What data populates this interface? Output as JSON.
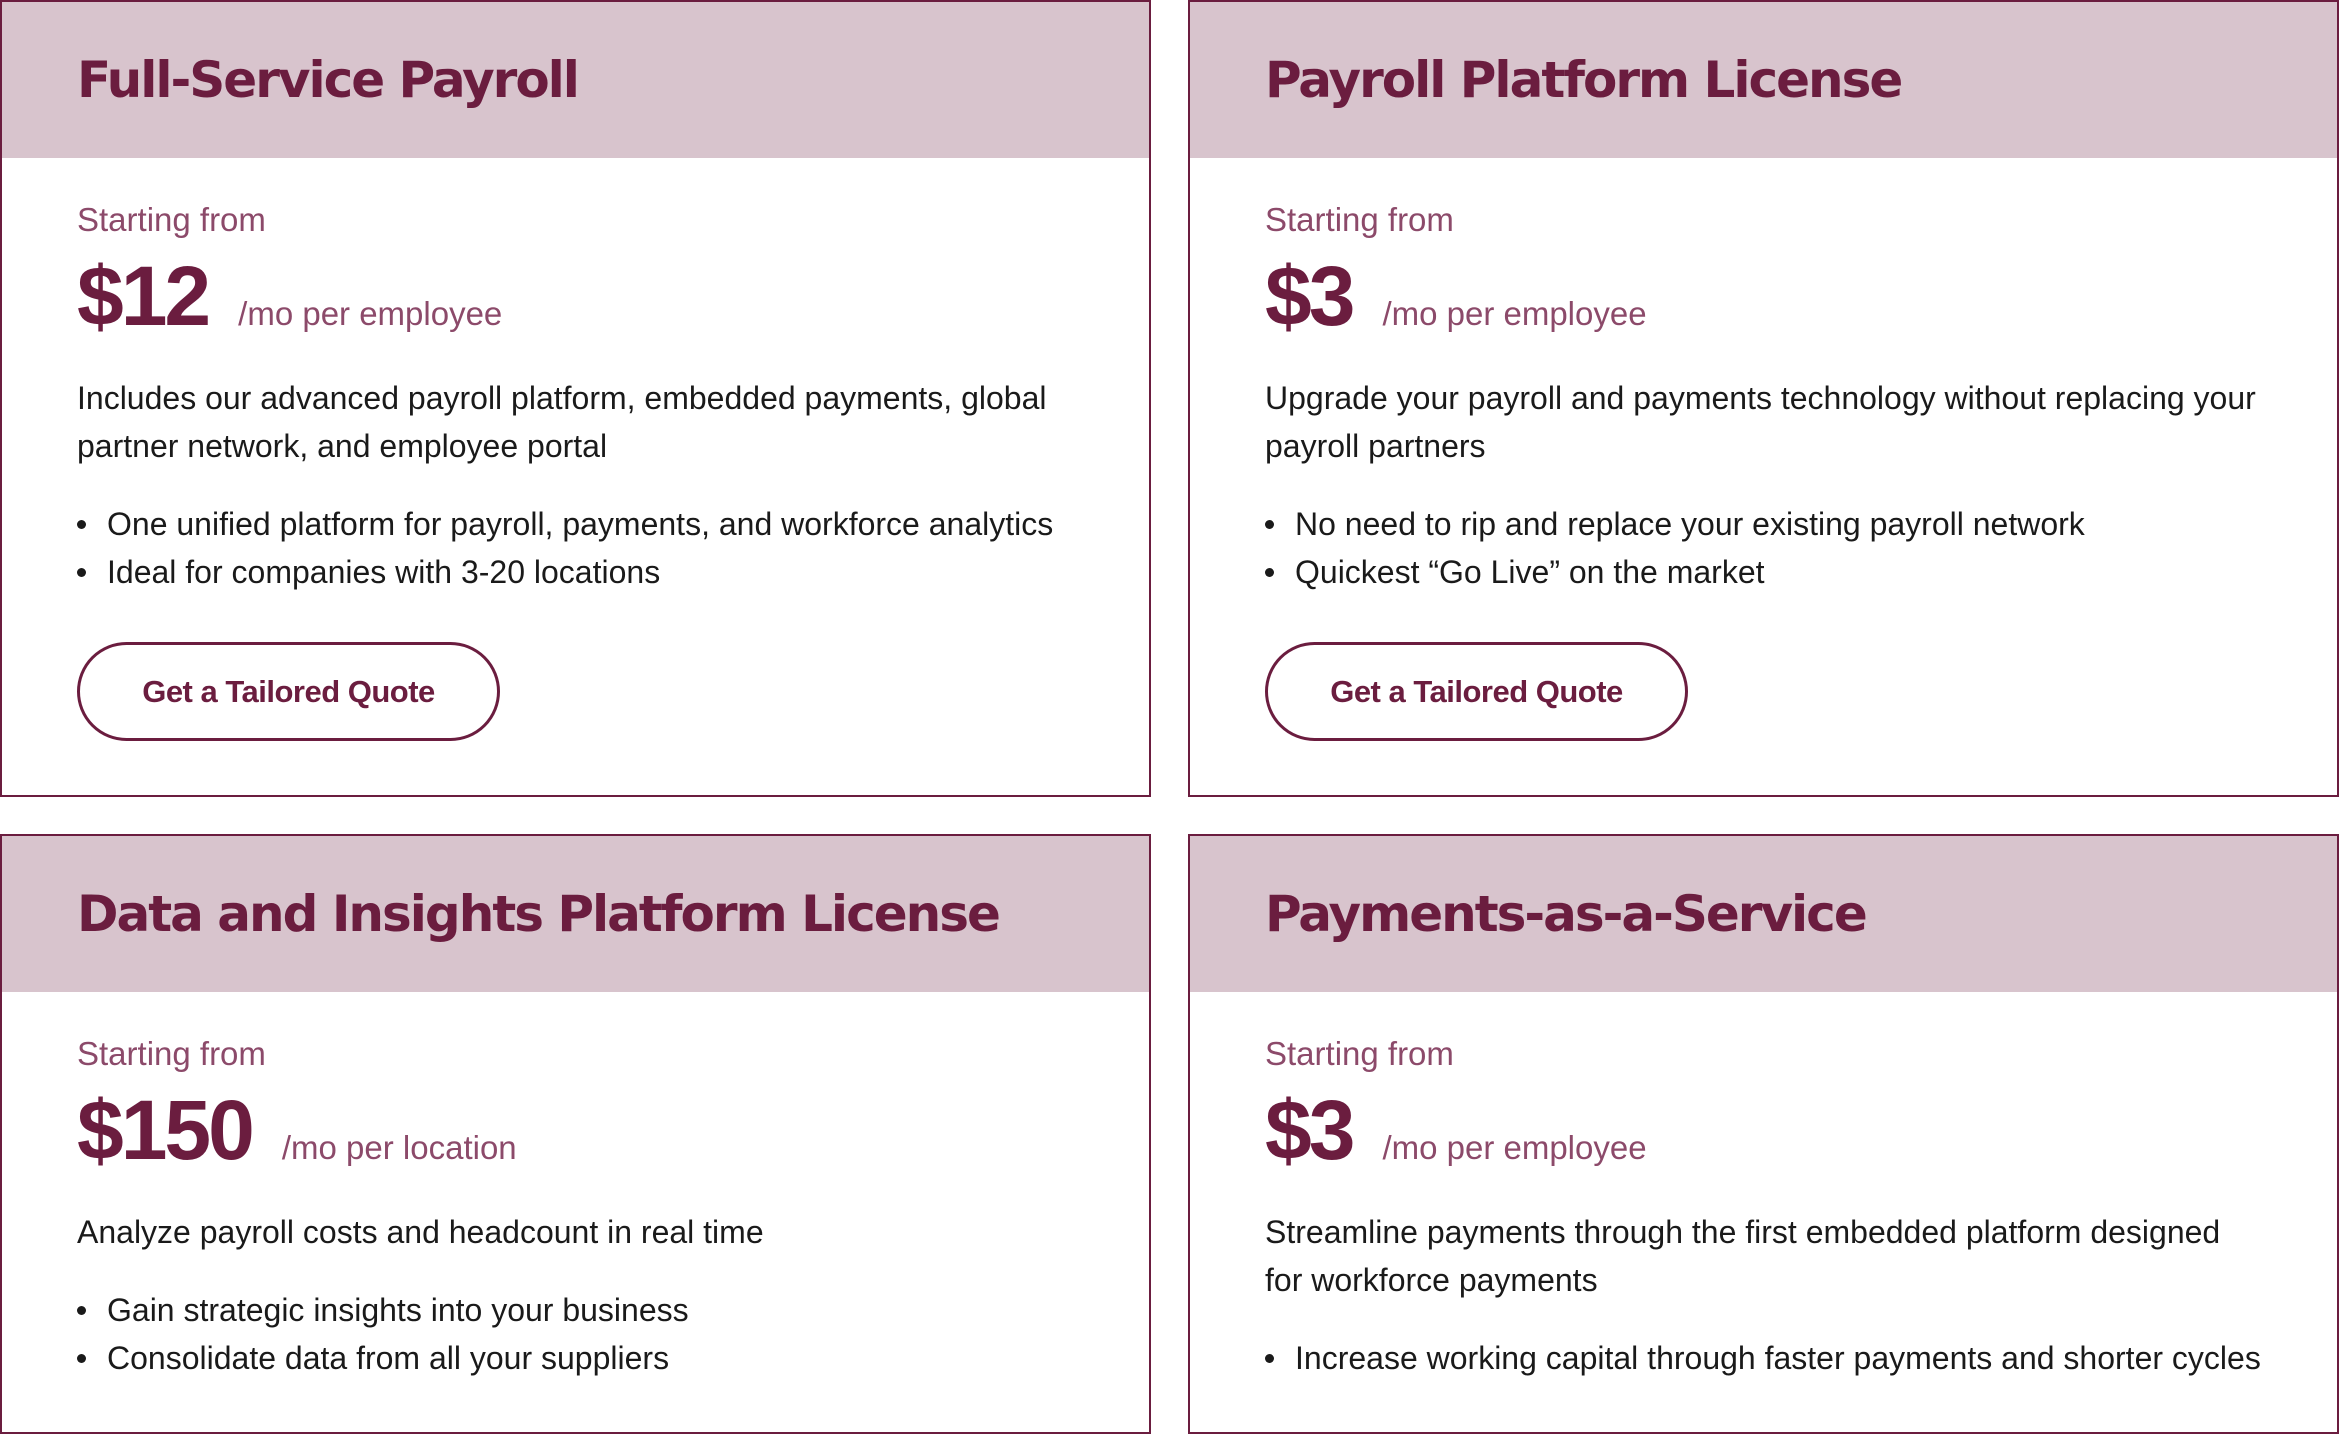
{
  "cards": [
    {
      "title": "Full-Service Payroll",
      "starting_from": "Starting from",
      "price": "$12",
      "unit": "/mo per employee",
      "description": "Includes our advanced payroll platform, embedded payments, global partner network, and employee portal",
      "bullets": [
        "One unified platform for payroll, payments, and workforce analytics",
        "Ideal for companies with 3-20 locations"
      ],
      "button_label": "Get a Tailored Quote"
    },
    {
      "title": "Payroll Platform License",
      "starting_from": "Starting from",
      "price": "$3",
      "unit": "/mo per employee",
      "description": "Upgrade your payroll and payments technology without replacing your payroll partners",
      "bullets": [
        "No need to rip and replace your existing payroll network",
        "Quickest “Go Live” on the market"
      ],
      "button_label": "Get a Tailored Quote"
    },
    {
      "title": "Data and Insights Platform License",
      "starting_from": "Starting from",
      "price": "$150",
      "unit": "/mo per location",
      "description": "Analyze payroll costs and headcount in real time",
      "bullets": [
        "Gain strategic insights into your business",
        "Consolidate data from all your suppliers"
      ]
    },
    {
      "title": "Payments-as-a-Service",
      "starting_from": "Starting from",
      "price": "$3",
      "unit": "/mo per employee",
      "description": "Streamline payments through the first embedded platform designed for workforce payments",
      "bullets": [
        "Increase working capital through faster payments and shorter cycles"
      ]
    }
  ],
  "colors": {
    "brand": "#6b1d3f",
    "header_bg": "#d8c4cd",
    "muted_text": "#8c4a6a",
    "body_text": "#1a1a1a"
  }
}
